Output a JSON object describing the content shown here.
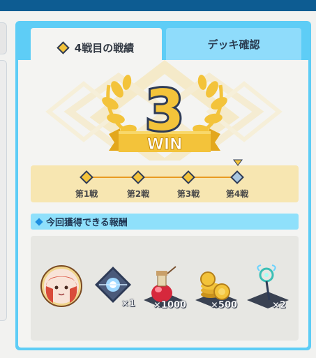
{
  "tabs": {
    "active_label": "4戦目の戦績",
    "inactive_label": "デッキ確認"
  },
  "score": {
    "wins": "3",
    "win_label": "WIN"
  },
  "progress": {
    "steps": [
      "第1戦",
      "第2戦",
      "第3戦",
      "第4戦"
    ],
    "current_step": 4
  },
  "rewards": {
    "header": "今回獲得できる報酬",
    "items": [
      {
        "icon": "character-portrait-icon",
        "qty": ""
      },
      {
        "icon": "crystal-gem-icon",
        "qty": "×1"
      },
      {
        "icon": "potion-bottle-icon",
        "qty": "×1000"
      },
      {
        "icon": "gold-coins-icon",
        "qty": "×500"
      },
      {
        "icon": "magic-staff-icon",
        "qty": "×2"
      }
    ]
  },
  "colors": {
    "header_bar": "#0d5c92",
    "panel_border": "#5ecdf6",
    "gold": "#f3c33a",
    "number_blue": "#2e3b56"
  }
}
